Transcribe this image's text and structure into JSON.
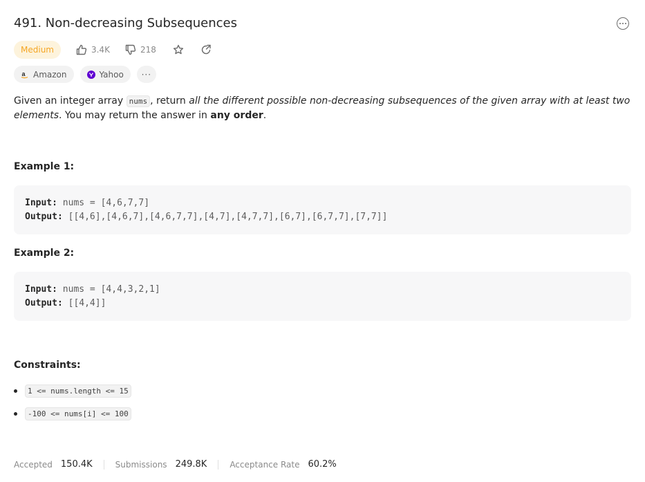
{
  "problem": {
    "title": "491. Non-decreasing Subsequences",
    "difficulty": "Medium",
    "likes": "3.4K",
    "dislikes": "218"
  },
  "tags": [
    {
      "label": "Amazon",
      "icon": "amazon-icon"
    },
    {
      "label": "Yahoo",
      "icon": "yahoo-icon"
    },
    {
      "label": "···",
      "icon": "more-icon"
    }
  ],
  "description": {
    "p1": "Given an integer array ",
    "code": "nums",
    "p2": ", return ",
    "em": "all the different possible non-decreasing subsequences of the given array with at least two elements",
    "p3": ". You may return the answer in ",
    "bold": "any order",
    "p4": "."
  },
  "examples": [
    {
      "title": "Example 1:",
      "input_label": "Input:",
      "input": "nums = [4,6,7,7]",
      "output_label": "Output:",
      "output": "[[4,6],[4,6,7],[4,6,7,7],[4,7],[4,7,7],[6,7],[6,7,7],[7,7]]"
    },
    {
      "title": "Example 2:",
      "input_label": "Input:",
      "input": "nums = [4,4,3,2,1]",
      "output_label": "Output:",
      "output": "[[4,4]]"
    }
  ],
  "constraints": {
    "title": "Constraints:",
    "items": [
      "1 <= nums.length <= 15",
      "-100 <= nums[i] <= 100"
    ]
  },
  "stats": {
    "accepted_label": "Accepted",
    "accepted": "150.4K",
    "submissions_label": "Submissions",
    "submissions": "249.8K",
    "rate_label": "Acceptance Rate",
    "rate": "60.2%"
  },
  "colors": {
    "medium_text": "#f5a623",
    "medium_bg": "#fdf3dc"
  }
}
